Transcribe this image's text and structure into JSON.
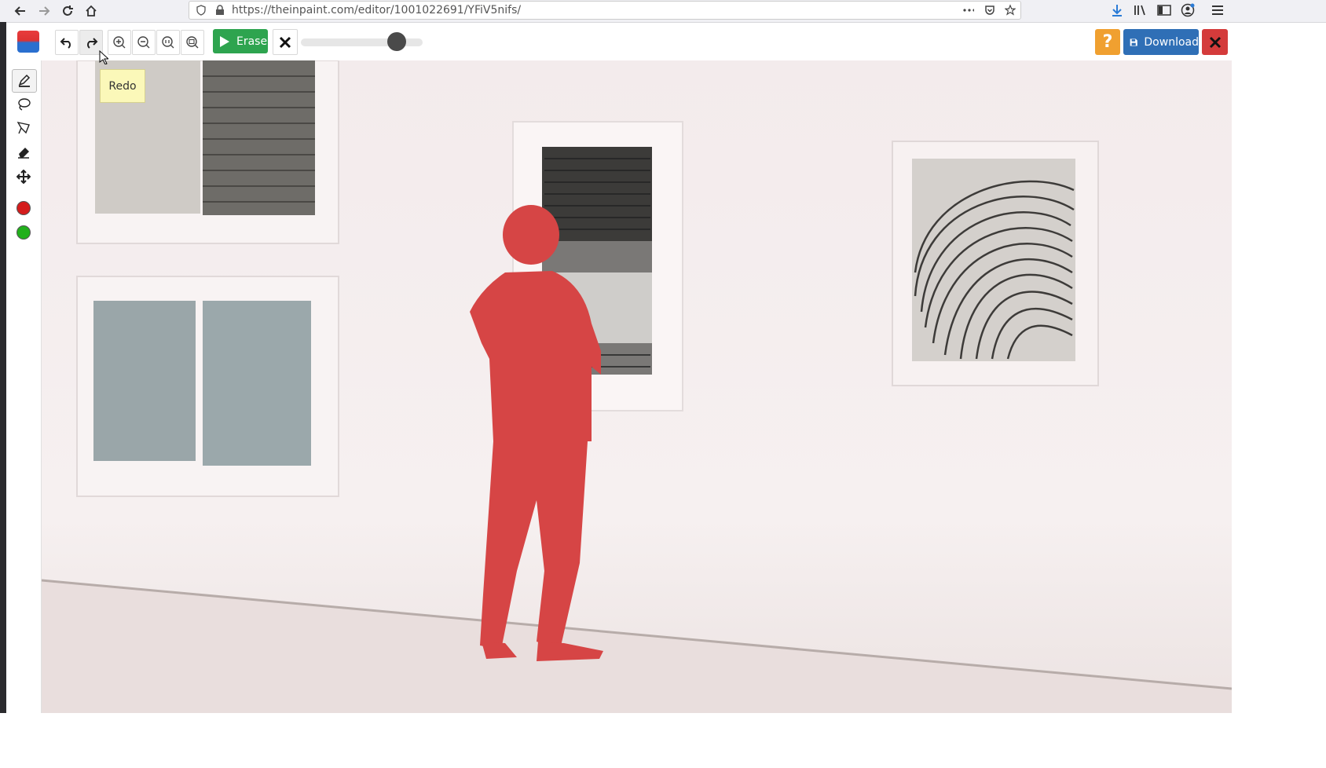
{
  "browser": {
    "url": "https://theinpaint.com/editor/1001022691/YFiV5nifs/",
    "icons": [
      "back-icon",
      "forward-icon",
      "reload-icon",
      "home-icon",
      "shield-icon",
      "lock-icon",
      "more-icon",
      "pocket-icon",
      "star-icon",
      "download-arrow-icon",
      "library-icon",
      "sidebar-icon",
      "account-icon",
      "menu-icon"
    ]
  },
  "toolbar": {
    "erase_label": "Erase",
    "download_label": "Download",
    "help_label": "?",
    "brush_size_percent": 84,
    "icons": [
      "undo-icon",
      "redo-icon",
      "zoom-in-icon",
      "zoom-out-icon",
      "zoom-actual-icon",
      "zoom-fit-icon",
      "play-icon",
      "clear-x-icon",
      "save-disk-icon",
      "close-x-icon"
    ]
  },
  "tooltip": {
    "text": "Redo"
  },
  "tools": [
    {
      "name": "marker",
      "icon": "pencil-marker-icon",
      "active": true
    },
    {
      "name": "lasso",
      "icon": "lasso-icon",
      "active": false
    },
    {
      "name": "polygon-lasso",
      "icon": "polygon-lasso-icon",
      "active": false
    },
    {
      "name": "eraser",
      "icon": "eraser-icon",
      "active": false
    },
    {
      "name": "move",
      "icon": "move-arrows-icon",
      "active": false
    }
  ],
  "colors": {
    "mask_red": "#d41c1c",
    "keep_green": "#22b01c",
    "erase_green": "#2ea44f",
    "download_blue": "#2f6fb6",
    "help_orange": "#f0a030",
    "close_red": "#d43b3b"
  }
}
